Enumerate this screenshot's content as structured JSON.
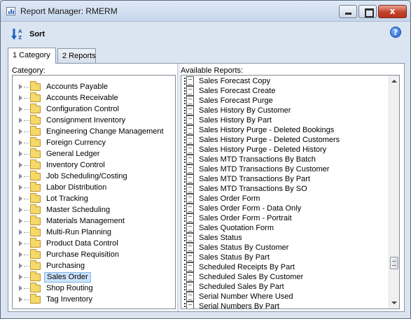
{
  "window": {
    "title": "Report Manager: RMERM",
    "close_glyph": "x"
  },
  "toolbar": {
    "sort_label": "Sort",
    "sort_icon": "sort-az-icon",
    "help_glyph": "?"
  },
  "tabs": [
    {
      "label": "1 Category",
      "active": true
    },
    {
      "label": "2 Reports",
      "active": false
    }
  ],
  "category_pane": {
    "label": "Category:",
    "selected": "Sales Order",
    "items": [
      "Accounts Payable",
      "Accounts Receivable",
      "Configuration Control",
      "Consignment Inventory",
      "Engineering Change Management",
      "Foreign Currency",
      "General Ledger",
      "Inventory Control",
      "Job Scheduling/Costing",
      "Labor Distribution",
      "Lot Tracking",
      "Master Scheduling",
      "Materials Management",
      "Multi-Run Planning",
      "Product Data Control",
      "Purchase Requisition",
      "Purchasing",
      "Sales Order",
      "Shop Routing",
      "Tag Inventory"
    ]
  },
  "reports_pane": {
    "label": "Available Reports:",
    "items": [
      "Sales Forecast Copy",
      "Sales Forecast Create",
      "Sales Forecast Purge",
      "Sales History By Customer",
      "Sales History By Part",
      "Sales History Purge - Deleted Bookings",
      "Sales History Purge - Deleted Customers",
      "Sales History Purge - Deleted History",
      "Sales MTD Transactions By Batch",
      "Sales MTD Transactions By Customer",
      "Sales MTD Transactions By Part",
      "Sales MTD Transactions By SO",
      "Sales Order Form",
      "Sales Order Form - Data Only",
      "Sales Order Form - Portrait",
      "Sales Quotation Form",
      "Sales Status",
      "Sales Status By Customer",
      "Sales Status By Part",
      "Scheduled Receipts By Part",
      "Scheduled Sales By Customer",
      "Scheduled Sales By Part",
      "Serial Number Where Used",
      "Serial Numbers By Part"
    ]
  }
}
